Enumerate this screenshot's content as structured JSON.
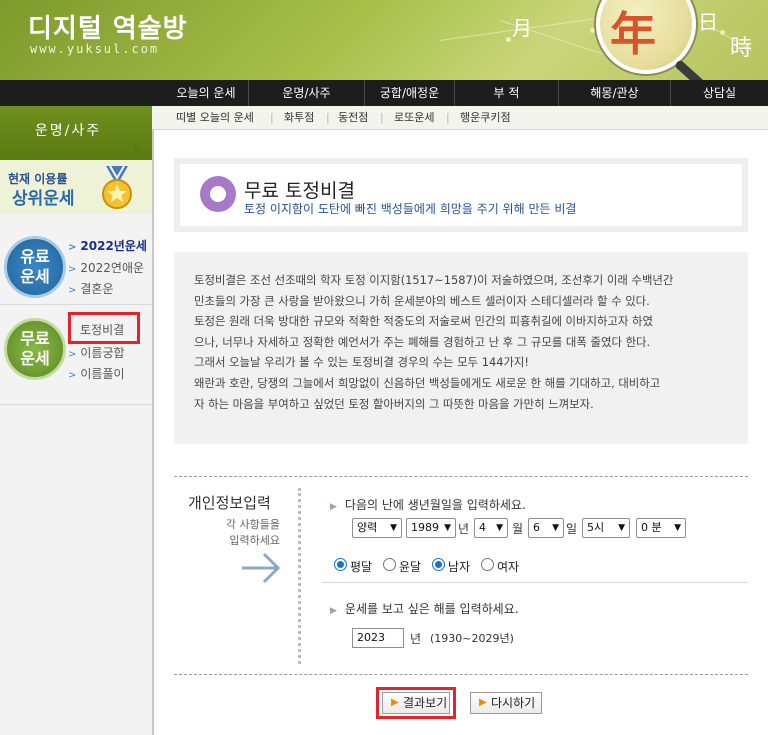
{
  "header": {
    "logo_title": "디지털 역술방",
    "logo_url": "www.yuksul.com",
    "char_month": "月",
    "char_year": "年",
    "char_day": "日",
    "char_time": "時"
  },
  "topnav": {
    "items": [
      "오늘의 운세",
      "운명/사주",
      "궁합/애정운",
      "부 적",
      "해몽/관상",
      "상담실"
    ]
  },
  "subnav": {
    "items": [
      "띠별 오늘의 운세",
      "화투점",
      "동전점",
      "로또운세",
      "행운쿠키점"
    ],
    "separator": "|"
  },
  "sidebar": {
    "section_title": "운명/사주",
    "rank_small": "현재 이용률",
    "rank_big": "상위운세",
    "paid_badge": [
      "유료",
      "운세"
    ],
    "free_badge": [
      "무료",
      "운세"
    ],
    "paid_links": [
      "2022년운세",
      "2022연애운",
      "결혼운"
    ],
    "free_links": [
      "토정비결",
      "이름궁합",
      "이름풀이"
    ],
    "chevron": ">"
  },
  "title_box": {
    "title": "무료 토정비결",
    "subtitle": "토정 이지함이 도탄에 빠진 백성들에게 희망을 주기 위해 만든 비결"
  },
  "description": {
    "lines": [
      "토정비결은 조선 선조때의 학자 토정 이지함(1517~1587)이 저술하였으며, 조선후기 이래 수백년간",
      "민초들의 가장 큰 사랑을 받아왔으니 가히 운세분야의 베스트 셀러이자 스테디셀러라 할 수 있다.",
      "토정은 원래 더욱 방대한 규모와 적확한 적중도의 저술로써 민간의 피흉취길에 이바지하고자 하였",
      "으나, 너무나 자세하고 정확한 예언서가 주는 폐해를 경험하고 난 후 그 규모를 대폭 줄였다 한다.",
      "그래서 오늘날 우리가 볼 수 있는 토정비결 경우의 수는 모두 144가지!",
      "왜란과 호란, 당쟁의 그늘에서 희망없이 신음하던 백성들에게도 새로운 한 해를 기대하고, 대비하고",
      "자 하는 마음을 부여하고 싶었던 토정 할아버지의 그 따뜻한 마음을 가만히 느껴보자."
    ]
  },
  "form": {
    "heading": "개인정보입력",
    "note_line1": "각 사항들을",
    "note_line2": "입력하세요",
    "instruction_birth": "다음의 난에 생년월일을 입력하세요.",
    "calendar_type": "양력",
    "birth_year": "1989",
    "birth_month": "4",
    "birth_day": "6",
    "birth_hour": "5시",
    "birth_minute": "0 분",
    "unit_year": "년",
    "unit_month": "월",
    "unit_day": "일",
    "radio_pyeongdal": "평달",
    "radio_yundal": "윤달",
    "radio_male": "남자",
    "radio_female": "여자",
    "instruction_year": "운세를 보고 싶은 해를 입력하세요.",
    "target_year": "2023",
    "target_year_unit": "년",
    "target_year_range": "(1930~2029년)",
    "tri": "▶",
    "dropdown_arrow": "▼"
  },
  "buttons": {
    "result": "결과보기",
    "reset": "다시하기",
    "arrow": "▶"
  },
  "colors": {
    "header_green": "#8aab36",
    "nav_black": "#1d1d1d",
    "highlight_red": "#e5232b",
    "title_purple": "#a67ac8",
    "link_blue": "#1a2f8c"
  }
}
